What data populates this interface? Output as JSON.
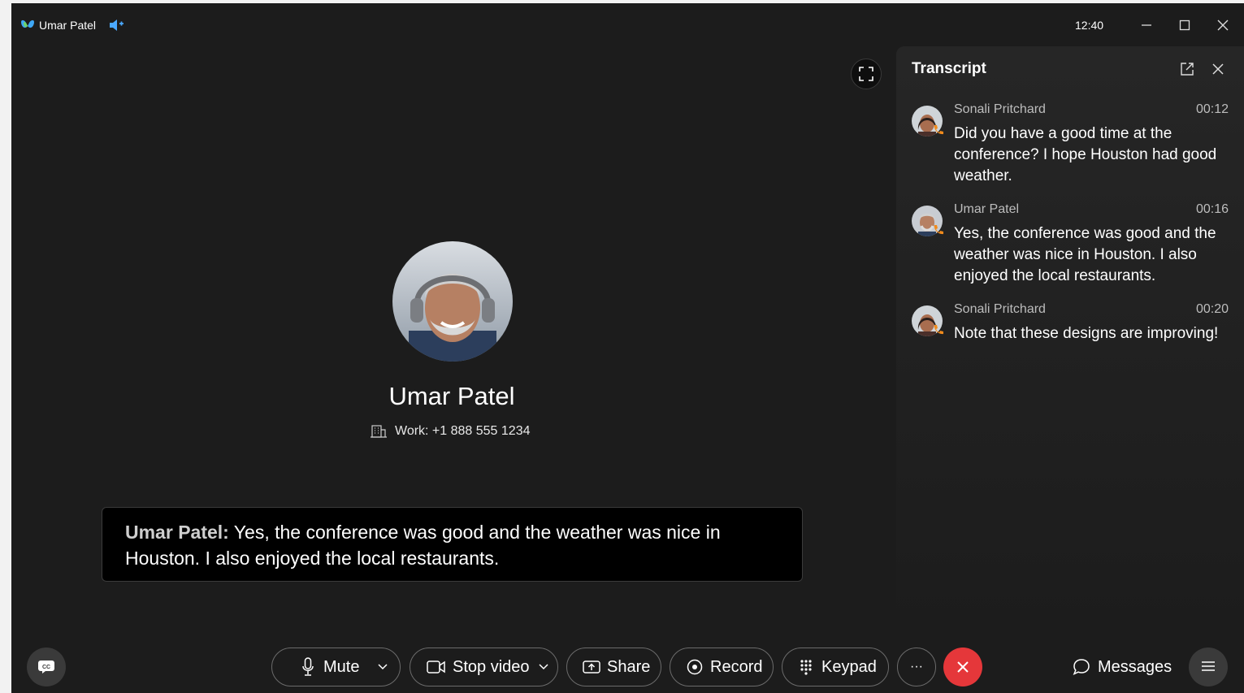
{
  "window": {
    "title": "Umar Patel",
    "clock": "12:40"
  },
  "caller": {
    "name": "Umar Patel",
    "phone": "Work: +1 888 555 1234"
  },
  "caption": {
    "speaker": "Umar Patel:",
    "text": " Yes, the conference was good and the weather was nice in Houston. I also enjoyed the local restaurants."
  },
  "transcript": {
    "title": "Transcript",
    "entries": [
      {
        "name": "Sonali Pritchard",
        "time": "00:12",
        "text": "Did you have a good time at the conference? I hope Houston had good weather."
      },
      {
        "name": "Umar Patel",
        "time": "00:16",
        "text": "Yes, the conference was good and the weather was nice in Houston. I also enjoyed the local restaurants."
      },
      {
        "name": "Sonali Pritchard",
        "time": "00:20",
        "text": "Note that these designs are improving!"
      }
    ]
  },
  "controls": {
    "mute": "Mute",
    "stop_video": "Stop video",
    "share": "Share",
    "record": "Record",
    "keypad": "Keypad",
    "more": "···",
    "messages": "Messages"
  },
  "colors": {
    "end_call": "#e5373a",
    "background": "#1c1c1c",
    "call_badge": "#f08a1c"
  }
}
